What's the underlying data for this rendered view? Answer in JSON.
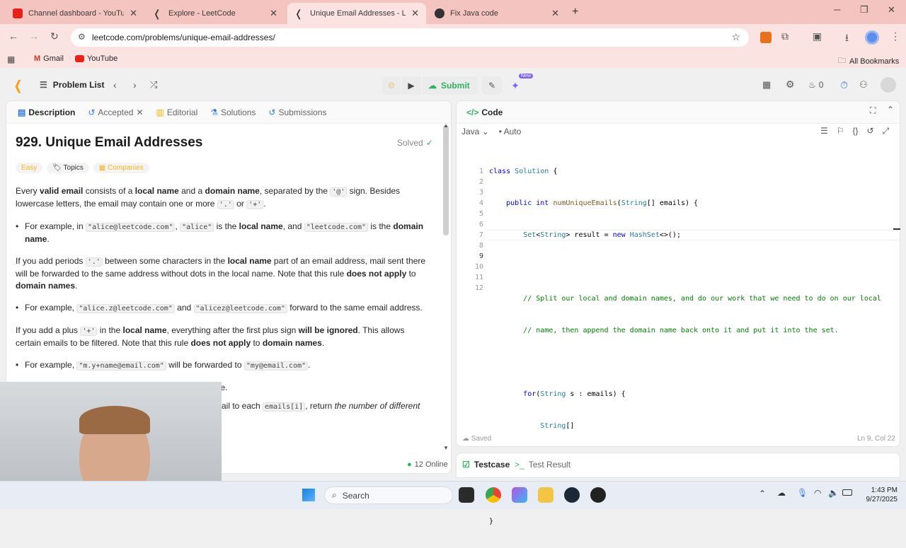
{
  "browser": {
    "tabs": [
      {
        "title": "Channel dashboard - YouTube"
      },
      {
        "title": "Explore - LeetCode"
      },
      {
        "title": "Unique Email Addresses - Leet"
      },
      {
        "title": "Fix Java code"
      }
    ],
    "url": "leetcode.com/problems/unique-email-addresses/",
    "bookmarks": {
      "gmail": "Gmail",
      "youtube": "YouTube",
      "all": "All Bookmarks"
    }
  },
  "header": {
    "problem_list": "Problem List",
    "submit": "Submit",
    "new_badge": "New",
    "streak": "0"
  },
  "left": {
    "tabs": {
      "description": "Description",
      "accepted": "Accepted",
      "editorial": "Editorial",
      "solutions": "Solutions",
      "submissions": "Submissions"
    },
    "title": "929. Unique Email Addresses",
    "solved": "Solved",
    "tags": {
      "easy": "Easy",
      "topics": "Topics",
      "companies": "Companies"
    },
    "p1": {
      "a": "Every ",
      "b": "valid email",
      "c": " consists of a ",
      "d": "local name",
      "e": " and a ",
      "f": "domain name",
      "g": ", separated by the ",
      "h": "'@'",
      "i": " sign. Besides lowercase letters, the email may contain one or more ",
      "j": "'.'",
      "k": " or ",
      "l": "'+'",
      "m": "."
    },
    "b1": {
      "a": "For example, in ",
      "b": "\"alice@leetcode.com\"",
      "c": ", ",
      "d": "\"alice\"",
      "e": " is the ",
      "f": "local name",
      "g": ", and ",
      "h": "\"leetcode.com\"",
      "i": " is the ",
      "j": "domain name",
      "k": "."
    },
    "p2": {
      "a": "If you add periods ",
      "b": "'.'",
      "c": " between some characters in the ",
      "d": "local name",
      "e": " part of an email address, mail sent there will be forwarded to the same address without dots in the local name. Note that this rule ",
      "f": "does not apply",
      "g": " to ",
      "h": "domain names",
      "i": "."
    },
    "b2": {
      "a": "For example, ",
      "b": "\"alice.z@leetcode.com\"",
      "c": " and ",
      "d": "\"alicez@leetcode.com\"",
      "e": " forward to the same email address."
    },
    "p3": {
      "a": "If you add a plus ",
      "b": "'+'",
      "c": " in the ",
      "d": "local name",
      "e": ", everything after the first plus sign ",
      "f": "will be ignored",
      "g": ". This allows certain emails to be filtered. Note that this rule ",
      "h": "does not apply",
      "i": " to ",
      "j": "domain names",
      "k": "."
    },
    "b3": {
      "a": "For example, ",
      "b": "\"m.y+name@email.com\"",
      "c": " will be forwarded to ",
      "d": "\"my@email.com\"",
      "e": "."
    },
    "p4": "It is possible to use both of these rules at the same time.",
    "p5": {
      "a": "ail to each ",
      "b": "emails[i]",
      "c": ", return ",
      "d": "the number of different"
    },
    "online": "12 Online"
  },
  "editor": {
    "title": "Code",
    "lang": "Java",
    "auto": "Auto",
    "lines": [
      "1",
      "2",
      "3",
      "4",
      "5",
      "6",
      "7",
      "8",
      "9",
      "10",
      "11",
      "12"
    ],
    "saved": "Saved",
    "cursor": "Ln 9, Col 22"
  },
  "bottom": {
    "testcase": "Testcase",
    "result": "Test Result"
  },
  "taskbar": {
    "search": "Search",
    "time": "1:43 PM",
    "date": "9/27/2025"
  }
}
